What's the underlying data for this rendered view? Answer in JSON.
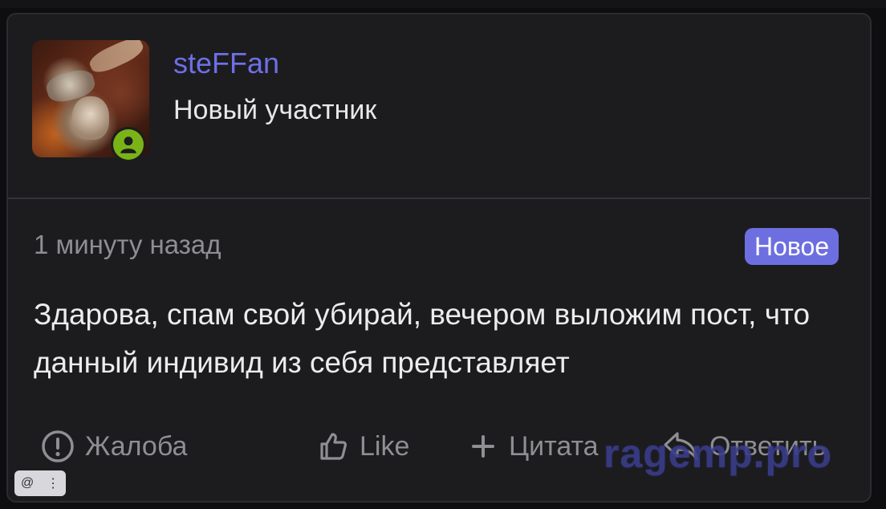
{
  "post": {
    "author": {
      "username": "steFFan",
      "role": "Новый участник",
      "status": "online"
    },
    "timestamp": "1 минуту назад",
    "new_badge": "Новое",
    "message": "Здарова, спам свой убирай, вечером выложим пост, что данный индивид из себя представляет",
    "actions": {
      "report": "Жалоба",
      "like": "Like",
      "quote": "Цитата",
      "reply": "Ответить"
    }
  },
  "watermark": "ragemp.pro",
  "toolbar": {
    "icons": [
      "at-icon",
      "more-vertical-icon"
    ]
  },
  "colors": {
    "accent": "#6d70e8",
    "badge": "#6d6fe0",
    "online": "#7ab317",
    "card_bg": "#1c1c1e",
    "muted_text": "#8e8e93"
  }
}
